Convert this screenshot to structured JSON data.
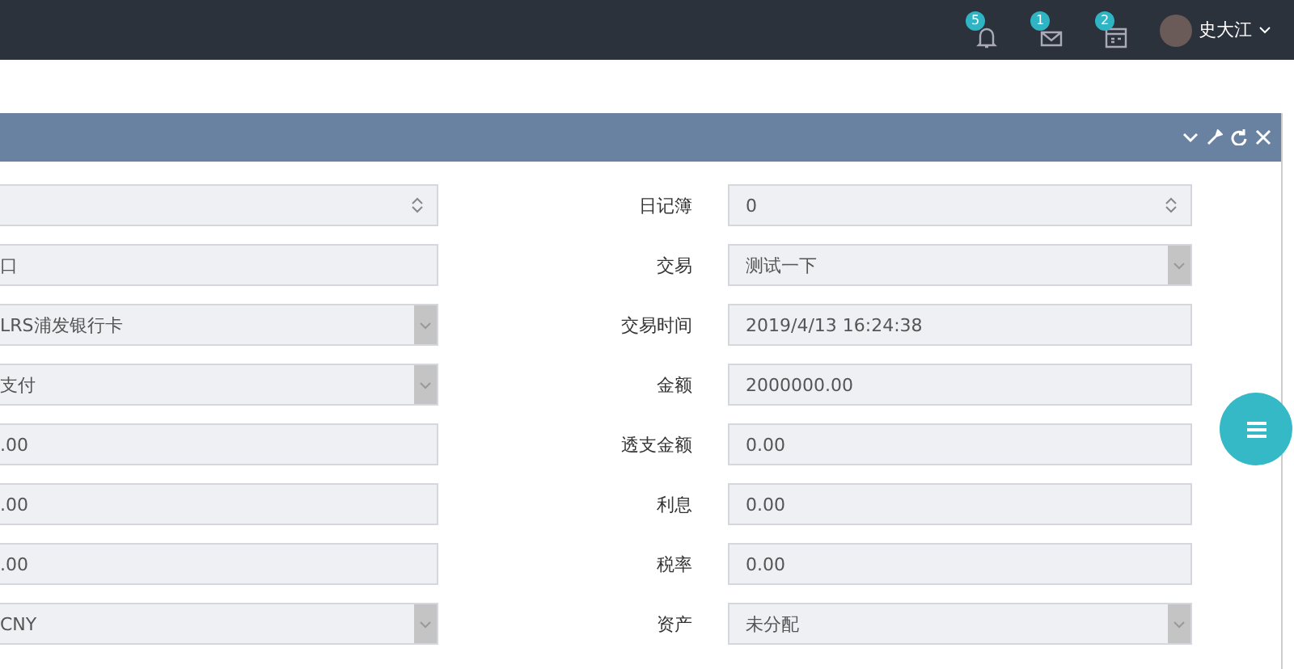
{
  "topbar": {
    "notifications": [
      {
        "kind": "bell",
        "count": "5"
      },
      {
        "kind": "mail",
        "count": "1"
      },
      {
        "kind": "calendar",
        "count": "2"
      }
    ],
    "user": {
      "name": "史大江"
    }
  },
  "panel": {
    "tools": [
      {
        "kind": "collapse"
      },
      {
        "kind": "settings"
      },
      {
        "kind": "refresh"
      },
      {
        "kind": "close"
      }
    ]
  },
  "left_fields": [
    {
      "kind": "spinner"
    },
    {
      "kind": "text",
      "value": "口"
    },
    {
      "kind": "select",
      "value": "LRS浦发银行卡"
    },
    {
      "kind": "select",
      "value": "支付"
    },
    {
      "kind": "text",
      "value": ".00"
    },
    {
      "kind": "text",
      "value": ".00"
    },
    {
      "kind": "text",
      "value": ".00"
    },
    {
      "kind": "select",
      "value": "CNY"
    }
  ],
  "right_fields": [
    {
      "label": "日记簿",
      "kind": "spinner",
      "value": "0"
    },
    {
      "label": "交易",
      "kind": "select",
      "value": "测试一下"
    },
    {
      "label": "交易时间",
      "kind": "text",
      "value": "2019/4/13 16:24:38"
    },
    {
      "label": "金额",
      "kind": "text",
      "value": "2000000.00"
    },
    {
      "label": "透支金额",
      "kind": "text",
      "value": "0.00"
    },
    {
      "label": "利息",
      "kind": "text",
      "value": "0.00"
    },
    {
      "label": "税率",
      "kind": "text",
      "value": "0.00"
    },
    {
      "label": "资产",
      "kind": "select",
      "value": "未分配"
    }
  ]
}
